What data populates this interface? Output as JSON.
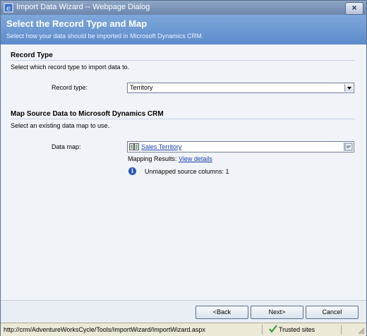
{
  "window": {
    "title": "Import Data Wizard -- Webpage Dialog",
    "close_label": "×"
  },
  "banner": {
    "title": "Select the Record Type and Map",
    "subtitle": "Select how your data should be imported in Microsoft Dynamics CRM."
  },
  "record_type": {
    "heading": "Record Type",
    "description": "Select which record type to import data to.",
    "label": "Record type:",
    "selected_value": "Territory"
  },
  "data_map": {
    "heading": "Map Source Data to Microsoft Dynamics CRM",
    "description": "Select an existing data map to use.",
    "label": "Data map:",
    "value": "Sales Territory",
    "mapping_results_label": "Mapping Results:",
    "view_details_link": "View details",
    "unmapped_text": "Unmapped source columns: 1"
  },
  "buttons": {
    "back": "<Back",
    "next": "Next>",
    "cancel": "Cancel"
  },
  "statusbar": {
    "url": "http://crm/AdventureWorksCycle/Tools/ImportWizard/ImportWizard.aspx",
    "zone": "Trusted sites"
  },
  "colors": {
    "banner": "#6b96d2",
    "link": "#1a3fa8",
    "titlebar": "#7d97bd"
  }
}
